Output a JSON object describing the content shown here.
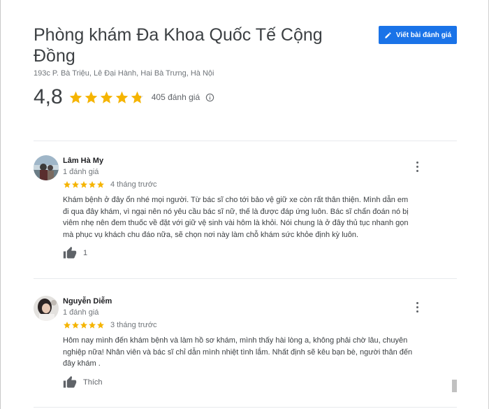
{
  "place": {
    "title": "Phòng khám Đa Khoa Quốc Tế Cộng Đồng",
    "address": "193c P. Bà Triệu, Lê Đại Hành, Hai Bà Trưng, Hà Nội"
  },
  "write_review_label": "Viết bài đánh giá",
  "rating": {
    "value": "4,8",
    "stars_out_of_5": 4.8,
    "count_label": "405 đánh giá"
  },
  "colors": {
    "accent": "#1a73e8",
    "star": "#f5b400",
    "star_empty": "#dadce0"
  },
  "reviews": [
    {
      "name": "Lâm Hà My",
      "meta": "1 đánh giá",
      "stars": 5,
      "time": "4 tháng trước",
      "text": "Khám bệnh ở đây ổn nhé mọi người. Từ bác sĩ cho tới bảo vệ giữ xe còn rất thân thiện. Mình dẫn em đi qua đây khám, vì ngại nên nó yêu cầu bác sĩ nữ, thế là được đáp ứng luôn. Bác sĩ chẩn đoán nó bị viêm nhẹ nên đem thuốc về đặt với giữ vệ sinh vài hôm là khỏi. Nói chung là ở đây thủ tục nhanh gọn  mà phục vụ khách chu đáo nữa, sẽ chọn nơi này làm chỗ khám sức khỏe định kỳ luôn.",
      "like_label": "1"
    },
    {
      "name": "Nguyễn Diễm",
      "meta": "1 đánh giá",
      "stars": 5,
      "time": "3 tháng trước",
      "text": "Hôm nay mình đến khám bệnh và làm hồ sơ khám, mình thấy hài lòng a,  không phải chờ lâu, chuyên nghiệp nữa! Nhân viên và bác sĩ chỉ dẫn mình nhiệt tình lắm. Nhất định sẽ kêu bạn bè, người thân đến đây khám .",
      "like_label": "Thích"
    }
  ]
}
